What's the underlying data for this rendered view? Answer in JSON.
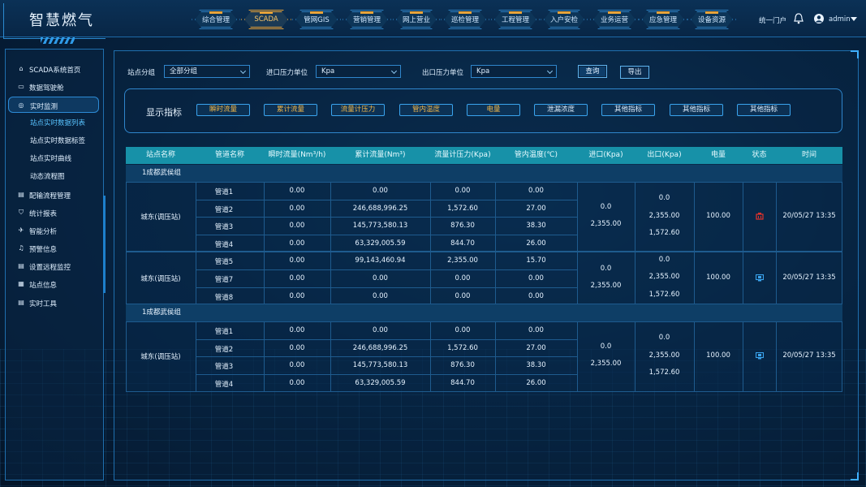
{
  "app_title": "智慧燃气",
  "nav": [
    {
      "label": "综合管理"
    },
    {
      "label": "SCADA",
      "active": true
    },
    {
      "label": "管网GIS"
    },
    {
      "label": "营销管理"
    },
    {
      "label": "网上营业"
    },
    {
      "label": "巡检管理"
    },
    {
      "label": "工程管理"
    },
    {
      "label": "入户安检"
    },
    {
      "label": "业务运营"
    },
    {
      "label": "应急管理"
    },
    {
      "label": "设备资源"
    }
  ],
  "header": {
    "portal": "统一门户",
    "user": "admin"
  },
  "sidebar": {
    "items": [
      {
        "label": "SCADA系统首页",
        "icon": "home-icon"
      },
      {
        "label": "数据驾驶舱",
        "icon": "dashboard-icon"
      },
      {
        "label": "实时监测",
        "icon": "monitor-icon",
        "open": true
      },
      {
        "label": "配输流程管理",
        "icon": "flow-icon"
      },
      {
        "label": "统计报表",
        "icon": "shield-icon"
      },
      {
        "label": "智能分析",
        "icon": "analysis-icon"
      },
      {
        "label": "预警信息",
        "icon": "bell-icon"
      },
      {
        "label": "设置远程监控",
        "icon": "remote-icon"
      },
      {
        "label": "站点信息",
        "icon": "site-icon"
      },
      {
        "label": "实时工具",
        "icon": "tool-icon"
      }
    ],
    "subitems": [
      {
        "label": "站点实时数据列表",
        "active": true
      },
      {
        "label": "站点实时数据标签"
      },
      {
        "label": "站点实时曲线"
      },
      {
        "label": "动态流程图"
      }
    ]
  },
  "filters": {
    "group_label": "站点分组",
    "group_value": "全部分组",
    "in_unit_label": "进口压力单位",
    "in_unit_value": "Kpa",
    "out_unit_label": "出口压力单位",
    "out_unit_value": "Kpa",
    "query": "查询",
    "export": "导出"
  },
  "indicators": {
    "title": "显示指标",
    "chips": [
      {
        "label": "瞬时流量",
        "on": true
      },
      {
        "label": "累计流量",
        "on": true
      },
      {
        "label": "流量计压力",
        "on": true
      },
      {
        "label": "管内温度",
        "on": true
      },
      {
        "label": "电量",
        "on": true
      },
      {
        "label": "泄漏浓度",
        "on": false
      },
      {
        "label": "其他指标",
        "on": false
      },
      {
        "label": "其他指标",
        "on": false
      },
      {
        "label": "其他指标",
        "on": false
      }
    ]
  },
  "table": {
    "headers": [
      "站点名称",
      "管道名称",
      "瞬时流量(Nm³/h)",
      "累计流量(Nm³)",
      "流量计压力(Kpa)",
      "管内温度(℃)",
      "进口(Kpa)",
      "出口(Kpa)",
      "电量",
      "状态",
      "时间"
    ],
    "groups": [
      {
        "name": "1成都武侯组",
        "blocks": [
          {
            "station": "城东(调压站)",
            "rows": [
              [
                "管道1",
                "0.00",
                "0.00",
                "0.00",
                "0.00"
              ],
              [
                "管道2",
                "0.00",
                "246,688,996.25",
                "1,572.60",
                "27.00"
              ],
              [
                "管道3",
                "0.00",
                "145,773,580.13",
                "876.30",
                "38.30"
              ],
              [
                "管道4",
                "0.00",
                "63,329,005.59",
                "844.70",
                "26.00"
              ]
            ],
            "inlet": [
              "0.0",
              "2,355.00"
            ],
            "outlet": [
              "0.0",
              "2,355.00",
              "1,572.60"
            ],
            "power": "100.00",
            "status": "alarm-icon",
            "status_color": "#e0322c",
            "time": "20/05/27 13:35"
          },
          {
            "station": "城东(调压站)",
            "rows": [
              [
                "管道5",
                "0.00",
                "99,143,460.94",
                "2,355.00",
                "15.70"
              ],
              [
                "管道7",
                "0.00",
                "0.00",
                "0.00",
                "0.00"
              ],
              [
                "管道8",
                "0.00",
                "0.00",
                "0.00",
                "0.00"
              ]
            ],
            "inlet": [
              "0.0",
              "2,355.00"
            ],
            "outlet": [
              "0.0",
              "2,355.00",
              "1,572.60"
            ],
            "power": "100.00",
            "status": "monitor-icon",
            "status_color": "#3aa4ee",
            "time": "20/05/27 13:35"
          }
        ]
      },
      {
        "name": "1成都武侯组",
        "blocks": [
          {
            "station": "城东(调压站)",
            "rows": [
              [
                "管道1",
                "0.00",
                "0.00",
                "0.00",
                "0.00"
              ],
              [
                "管道2",
                "0.00",
                "246,688,996.25",
                "1,572.60",
                "27.00"
              ],
              [
                "管道3",
                "0.00",
                "145,773,580.13",
                "876.30",
                "38.30"
              ],
              [
                "管道4",
                "0.00",
                "63,329,005.59",
                "844.70",
                "26.00"
              ]
            ],
            "inlet": [
              "0.0",
              "2,355.00"
            ],
            "outlet": [
              "0.0",
              "2,355.00",
              "1,572.60"
            ],
            "power": "100.00",
            "status": "monitor-icon",
            "status_color": "#3aa4ee",
            "time": "20/05/27 13:35"
          }
        ]
      }
    ]
  }
}
